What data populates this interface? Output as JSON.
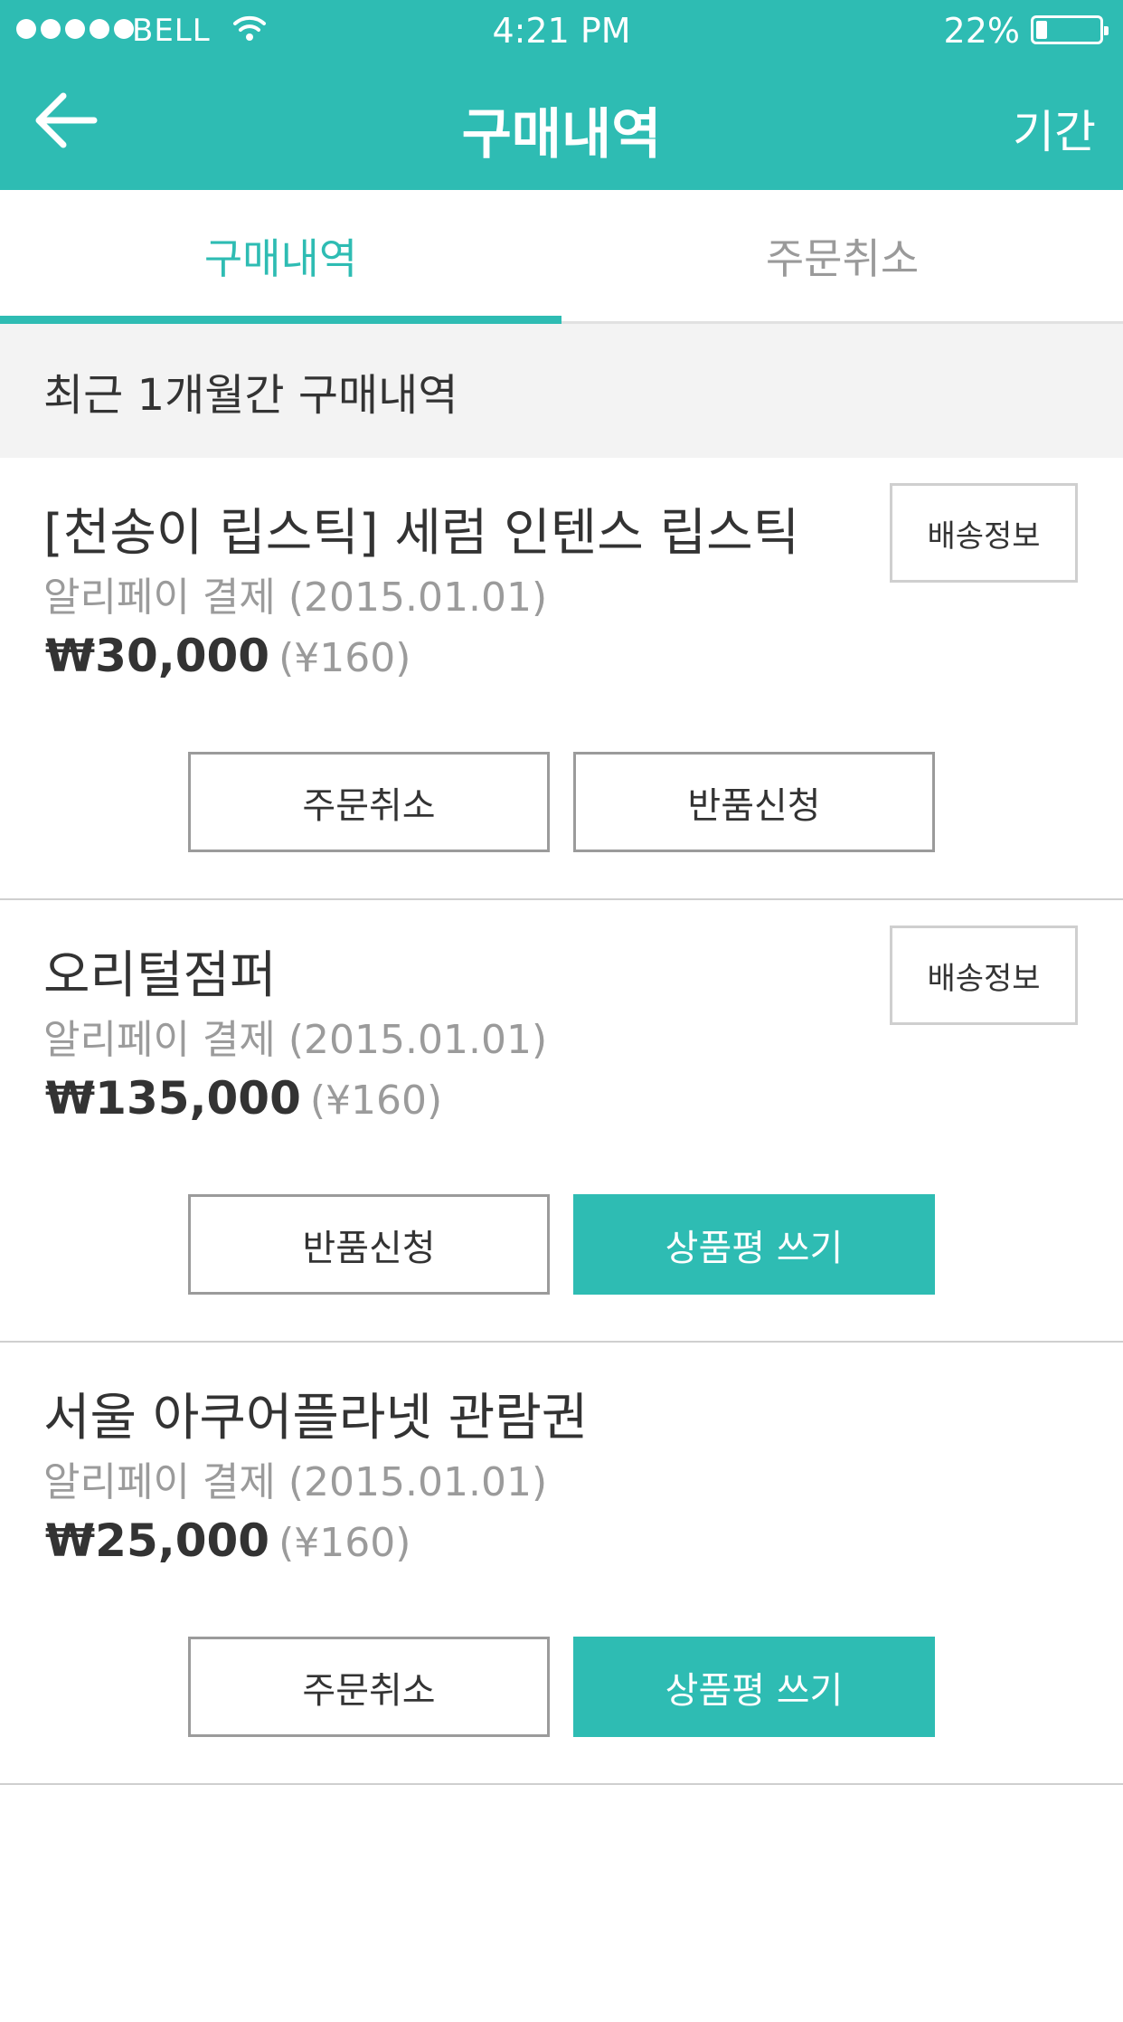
{
  "status_bar": {
    "carrier": "BELL",
    "time": "4:21 PM",
    "battery_percent": "22%",
    "battery_level": 0.22
  },
  "header": {
    "title": "구매내역",
    "back_icon": "arrow-left-icon",
    "period_label": "기간"
  },
  "tabs": [
    {
      "label": "구매내역",
      "active": true
    },
    {
      "label": "주문취소",
      "active": false
    }
  ],
  "section_title": "최근 1개월간 구매내역",
  "orders": [
    {
      "name": "[천송이 립스틱] 세럼 인텐스 립스틱",
      "payment": "알리페이 결제  (2015.01.01)",
      "price": "₩30,000",
      "price_cny": "(¥160)",
      "shipping_label": "배송정보",
      "actions": [
        {
          "label": "주문취소",
          "primary": false
        },
        {
          "label": "반품신청",
          "primary": false
        }
      ]
    },
    {
      "name": "오리털점퍼",
      "payment": "알리페이 결제  (2015.01.01)",
      "price": "₩135,000",
      "price_cny": "(¥160)",
      "shipping_label": "배송정보",
      "actions": [
        {
          "label": "반품신청",
          "primary": false
        },
        {
          "label": "상품평 쓰기",
          "primary": true
        }
      ]
    },
    {
      "name": "서울 아쿠어플라넷 관람권",
      "payment": "알리페이 결제  (2015.01.01)",
      "price": "₩25,000",
      "price_cny": "(¥160)",
      "actions": [
        {
          "label": "주문취소",
          "primary": false
        },
        {
          "label": "상품평 쓰기",
          "primary": true
        }
      ]
    }
  ],
  "colors": {
    "accent": "#2ebcb3",
    "text": "#333333",
    "muted": "#9b9b9b",
    "section_bg": "#f3f3f3"
  }
}
